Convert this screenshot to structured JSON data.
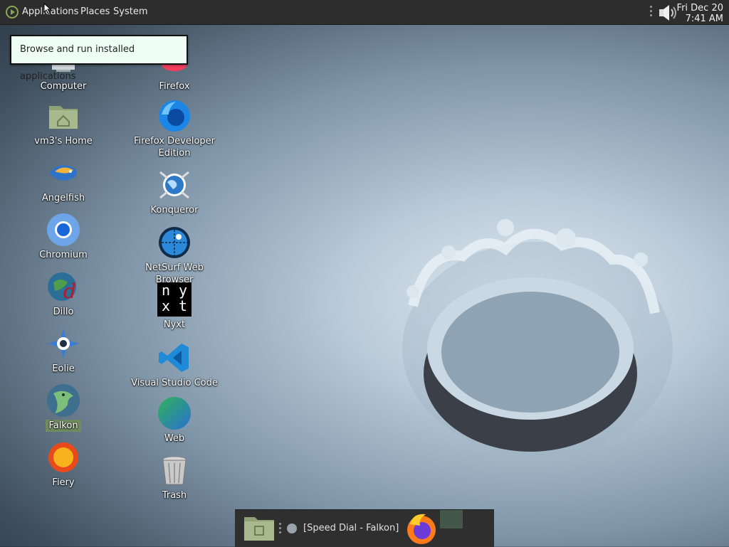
{
  "top_panel": {
    "menus": [
      "Applications",
      "Places",
      "System"
    ],
    "clock_date": "Fri Dec 20",
    "clock_time": "7:41 AM",
    "icons": [
      "mate-menu-icon",
      "volume-icon"
    ]
  },
  "tooltip": "Browse and run installed applications",
  "desktop": {
    "left_column": [
      {
        "label": "Computer",
        "icon": "computer-icon"
      },
      {
        "label": "vm3's Home",
        "icon": "home-folder-icon"
      },
      {
        "label": "Angelfish",
        "icon": "angelfish-icon"
      },
      {
        "label": "Chromium",
        "icon": "chromium-icon"
      },
      {
        "label": "Dillo",
        "icon": "dillo-icon"
      },
      {
        "label": "Eolie",
        "icon": "eolie-icon"
      },
      {
        "label": "Falkon",
        "icon": "falkon-icon"
      },
      {
        "label": "Fiery",
        "icon": "fiery-icon"
      }
    ],
    "right_column": [
      {
        "label": "Firefox",
        "icon": "firefox-icon"
      },
      {
        "label": "Firefox Developer",
        "label2": "Edition",
        "icon": "firefox-developer-icon"
      },
      {
        "label": "Konqueror",
        "icon": "konqueror-icon"
      },
      {
        "label": "NetSurf Web Browser",
        "icon": "netsurf-icon"
      },
      {
        "label": "Nyxt",
        "icon": "nyxt-icon",
        "glyph": "n y\nx t"
      },
      {
        "label": "Visual Studio Code",
        "icon": "vscode-icon"
      },
      {
        "label": "Web",
        "icon": "web-icon"
      },
      {
        "label": "Trash",
        "icon": "trash-icon"
      }
    ]
  },
  "bottom_panel": {
    "task_label": "[Speed Dial - Falkon]",
    "icons": [
      "show-desktop-icon",
      "falkon-task-icon",
      "firefox-launcher-icon"
    ]
  },
  "colors": {
    "panel": "#2d2d2d",
    "tooltip_bg": "#f0fff5",
    "selection": "#6f8c60"
  }
}
